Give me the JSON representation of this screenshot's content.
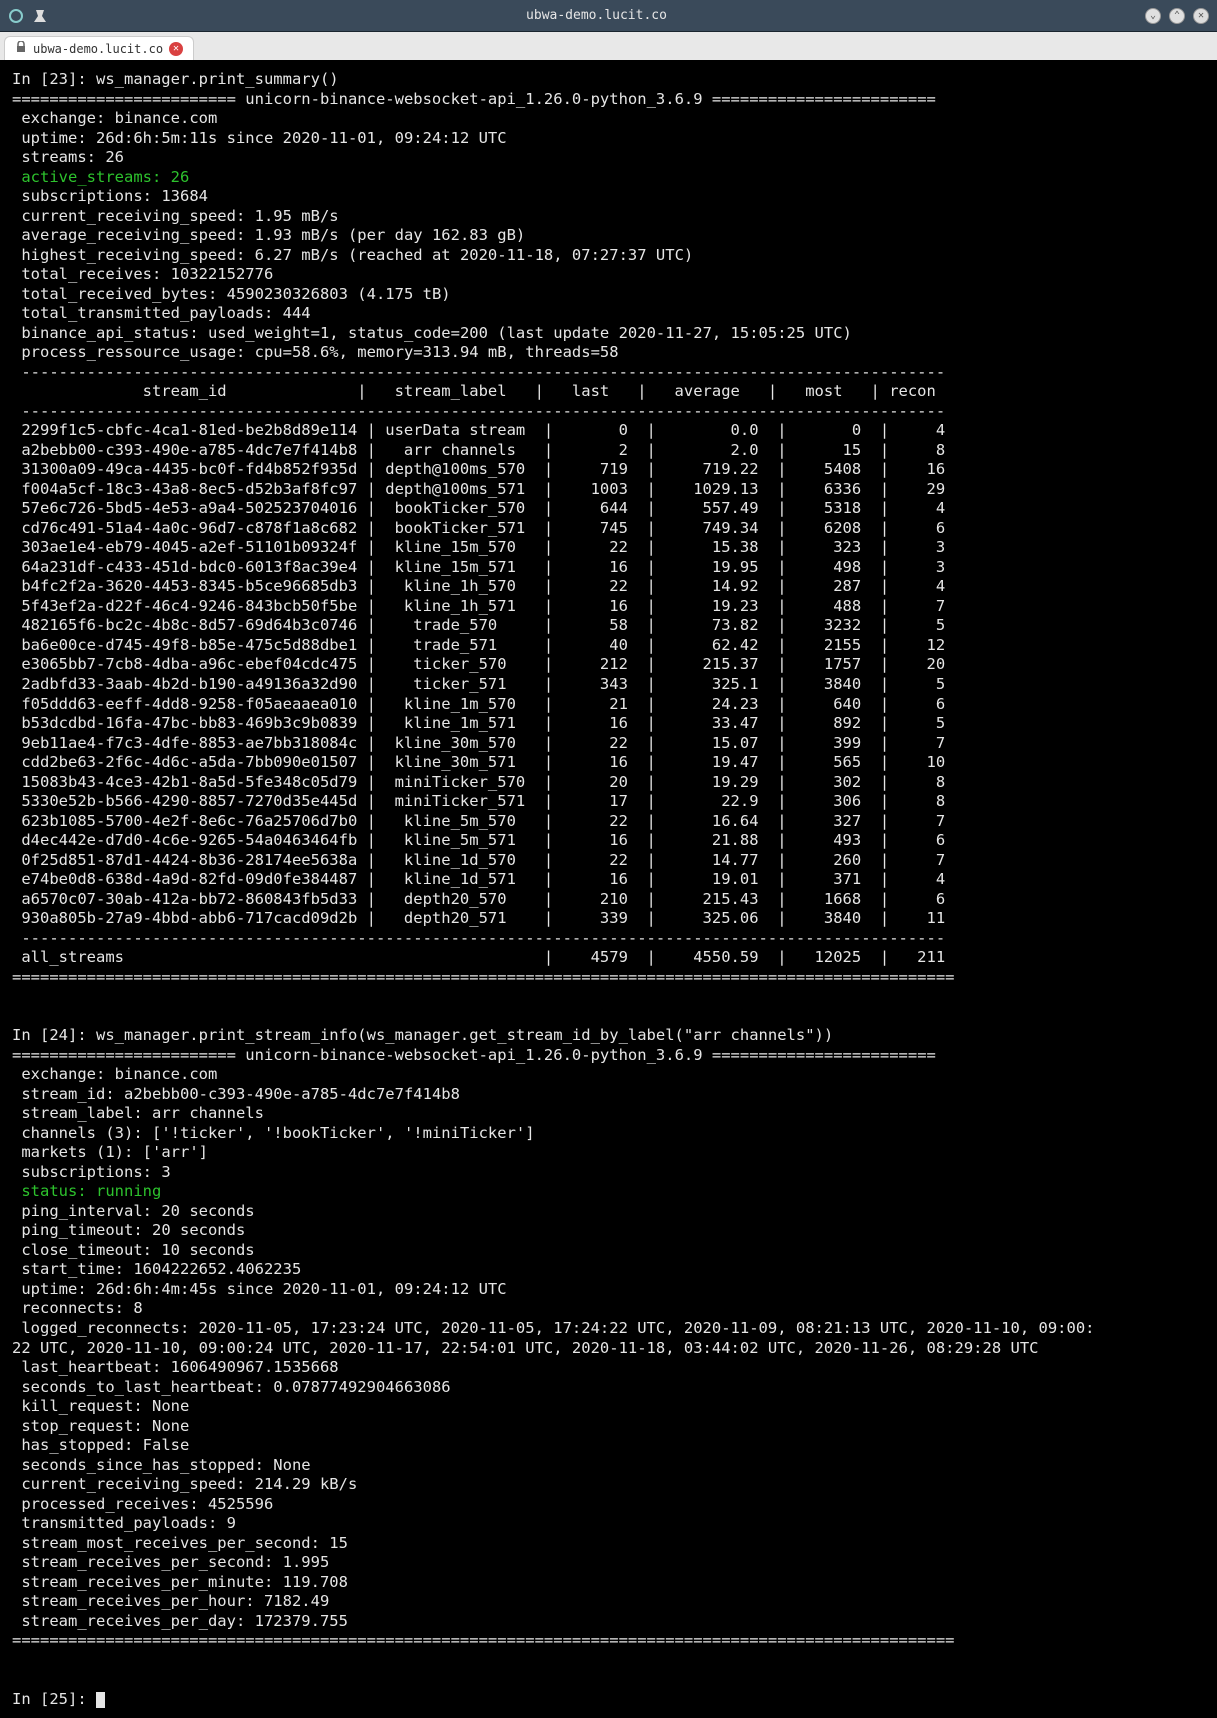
{
  "window": {
    "title": "ubwa-demo.lucit.co",
    "tab_label": "ubwa-demo.lucit.co"
  },
  "session1": {
    "prompt": "In [23]: ws_manager.print_summary()",
    "banner_prefix": "========================",
    "banner_title": " unicorn-binance-websocket-api_1.26.0-python_3.6.9 ",
    "banner_suffix": "========================",
    "exchange": "exchange: binance.com",
    "uptime": "uptime: 26d:6h:5m:11s since 2020-11-01, 09:24:12 UTC",
    "streams": "streams: 26",
    "active_streams": "active_streams: 26",
    "subscriptions": "subscriptions: 13684",
    "current_recv": "current_receiving_speed: 1.95 mB/s",
    "avg_recv": "average_receiving_speed: 1.93 mB/s (per day 162.83 gB)",
    "highest_recv": "highest_receiving_speed: 6.27 mB/s (reached at 2020-11-18, 07:27:37 UTC)",
    "total_recv": "total_receives: 10322152776",
    "total_bytes": "total_received_bytes: 4590230326803 (4.175 tB)",
    "total_tx": "total_transmitted_payloads: 444",
    "api_status": "binance_api_status: used_weight=1, status_code=200 (last update 2020-11-27, 15:05:25 UTC)",
    "proc_usage": "process_ressource_usage: cpu=58.6%, memory=313.94 mB, threads=58",
    "sep": " ---------------------------------------------------------------------------------------------------",
    "header_row": "              stream_id              |   stream_label   |   last   |   average   |   most   | recon",
    "rows": [
      " 2299f1c5-cbfc-4ca1-81ed-be2b8d89e114 | userData stream  |       0  |        0.0  |       0  |     4",
      " a2bebb00-c393-490e-a785-4dc7e7f414b8 |   arr channels   |       2  |        2.0  |      15  |     8",
      " 31300a09-49ca-4435-bc0f-fd4b852f935d | depth@100ms_570  |     719  |     719.22  |    5408  |    16",
      " f004a5cf-18c3-43a8-8ec5-d52b3af8fc97 | depth@100ms_571  |    1003  |    1029.13  |    6336  |    29",
      " 57e6c726-5bd5-4e53-a9a4-502523704016 |  bookTicker_570  |     644  |     557.49  |    5318  |     4",
      " cd76c491-51a4-4a0c-96d7-c878f1a8c682 |  bookTicker_571  |     745  |     749.34  |    6208  |     6",
      " 303ae1e4-eb79-4045-a2ef-51101b09324f |  kline_15m_570   |      22  |      15.38  |     323  |     3",
      " 64a231df-c433-451d-bdc0-6013f8ac39e4 |  kline_15m_571   |      16  |      19.95  |     498  |     3",
      " b4fc2f2a-3620-4453-8345-b5ce96685db3 |   kline_1h_570   |      22  |      14.92  |     287  |     4",
      " 5f43ef2a-d22f-46c4-9246-843bcb50f5be |   kline_1h_571   |      16  |      19.23  |     488  |     7",
      " 482165f6-bc2c-4b8c-8d57-69d64b3c0746 |    trade_570     |      58  |      73.82  |    3232  |     5",
      " ba6e00ce-d745-49f8-b85e-475c5d88dbe1 |    trade_571     |      40  |      62.42  |    2155  |    12",
      " e3065bb7-7cb8-4dba-a96c-ebef04cdc475 |    ticker_570    |     212  |     215.37  |    1757  |    20",
      " 2adbfd33-3aab-4b2d-b190-a49136a32d90 |    ticker_571    |     343  |      325.1  |    3840  |     5",
      " f05ddd63-eeff-4dd8-9258-f05aeaaea010 |   kline_1m_570   |      21  |      24.23  |     640  |     6",
      " b53dcdbd-16fa-47bc-bb83-469b3c9b0839 |   kline_1m_571   |      16  |      33.47  |     892  |     5",
      " 9eb11ae4-f7c3-4dfe-8853-ae7bb318084c |  kline_30m_570   |      22  |      15.07  |     399  |     7",
      " cdd2be63-2f6c-4d6c-a5da-7bb090e01507 |  kline_30m_571   |      16  |      19.47  |     565  |    10",
      " 15083b43-4ce3-42b1-8a5d-5fe348c05d79 |  miniTicker_570  |      20  |      19.29  |     302  |     8",
      " 5330e52b-b566-4290-8857-7270d35e445d |  miniTicker_571  |      17  |       22.9  |     306  |     8",
      " 623b1085-5700-4e2f-8e6c-76a25706d7b0 |   kline_5m_570   |      22  |      16.64  |     327  |     7",
      " d4ec442e-d7d0-4c6e-9265-54a0463464fb |   kline_5m_571   |      16  |      21.88  |     493  |     6",
      " 0f25d851-87d1-4424-8b36-28174ee5638a |   kline_1d_570   |      22  |      14.77  |     260  |     7",
      " e74be0d8-638d-4a9d-82fd-09d0fe384487 |   kline_1d_571   |      16  |      19.01  |     371  |     4",
      " a6570c07-30ab-412a-bb72-860843fb5d33 |   depth20_570    |     210  |     215.43  |    1668  |     6",
      " 930a805b-27a9-4bbd-abb6-717cacd09d2b |   depth20_571    |     339  |     325.06  |    3840  |    11"
    ],
    "total_row": " all_streams                                             |    4579  |    4550.59  |   12025  |   211",
    "bottom_sep": "====================================================================================================="
  },
  "session2": {
    "prompt": "In [24]: ws_manager.print_stream_info(ws_manager.get_stream_id_by_label(\"arr channels\"))",
    "banner_prefix": "========================",
    "banner_title": " unicorn-binance-websocket-api_1.26.0-python_3.6.9 ",
    "banner_suffix": "========================",
    "exchange": "exchange: binance.com",
    "stream_id": "stream_id: a2bebb00-c393-490e-a785-4dc7e7f414b8",
    "stream_label": "stream_label: arr channels",
    "channels": "channels (3): ['!ticker', '!bookTicker', '!miniTicker']",
    "markets": "markets (1): ['arr']",
    "subs": "subscriptions: 3",
    "status": "status: running",
    "ping_interval": "ping_interval: 20 seconds",
    "ping_timeout": "ping_timeout: 20 seconds",
    "close_timeout": "close_timeout: 10 seconds",
    "start_time": "start_time: 1604222652.4062235",
    "uptime": "uptime: 26d:6h:4m:45s since 2020-11-01, 09:24:12 UTC",
    "reconnects": "reconnects: 8",
    "logged_reconnects1": " logged_reconnects: 2020-11-05, 17:23:24 UTC, 2020-11-05, 17:24:22 UTC, 2020-11-09, 08:21:13 UTC, 2020-11-10, 09:00:",
    "logged_reconnects2": "22 UTC, 2020-11-10, 09:00:24 UTC, 2020-11-17, 22:54:01 UTC, 2020-11-18, 03:44:02 UTC, 2020-11-26, 08:29:28 UTC",
    "last_heartbeat": "last_heartbeat: 1606490967.1535668",
    "sec_hb": "seconds_to_last_heartbeat: 0.07877492904663086",
    "kill_req": "kill_request: None",
    "stop_req": "stop_request: None",
    "has_stopped": "has_stopped: False",
    "sec_since": "seconds_since_has_stopped: None",
    "cur_recv": "current_receiving_speed: 214.29 kB/s",
    "proc_recv": "processed_receives: 4525596",
    "tx_pay": "transmitted_payloads: 9",
    "most_rps": "stream_most_receives_per_second: 15",
    "rps": "stream_receives_per_second: 1.995",
    "rpm": "stream_receives_per_minute: 119.708",
    "rph": "stream_receives_per_hour: 7182.49",
    "rpd": "stream_receives_per_day: 172379.755",
    "bottom_sep": "====================================================================================================="
  },
  "prompt3": "In [25]: "
}
